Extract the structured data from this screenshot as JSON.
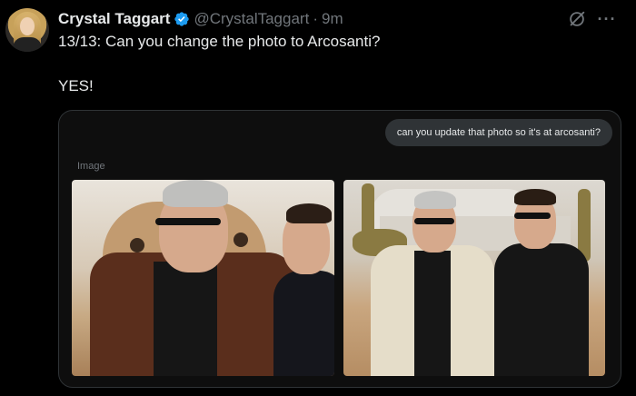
{
  "tweet": {
    "author_name": "Crystal Taggart",
    "handle": "@CrystalTaggart",
    "separator": "·",
    "time": "9m",
    "text_line1": "13/13: Can you change the photo to Arcosanti?",
    "text_line2": "YES!",
    "more_label": "···"
  },
  "card": {
    "prompt": "can you update that photo so it's at arcosanti?",
    "image_label": "Image"
  },
  "icons": {
    "verified": "verified-badge-icon",
    "grok": "grok-icon",
    "more": "more-icon"
  },
  "colors": {
    "background": "#000000",
    "text": "#e7e9ea",
    "muted": "#71767b",
    "verified": "#1d9bf0"
  }
}
